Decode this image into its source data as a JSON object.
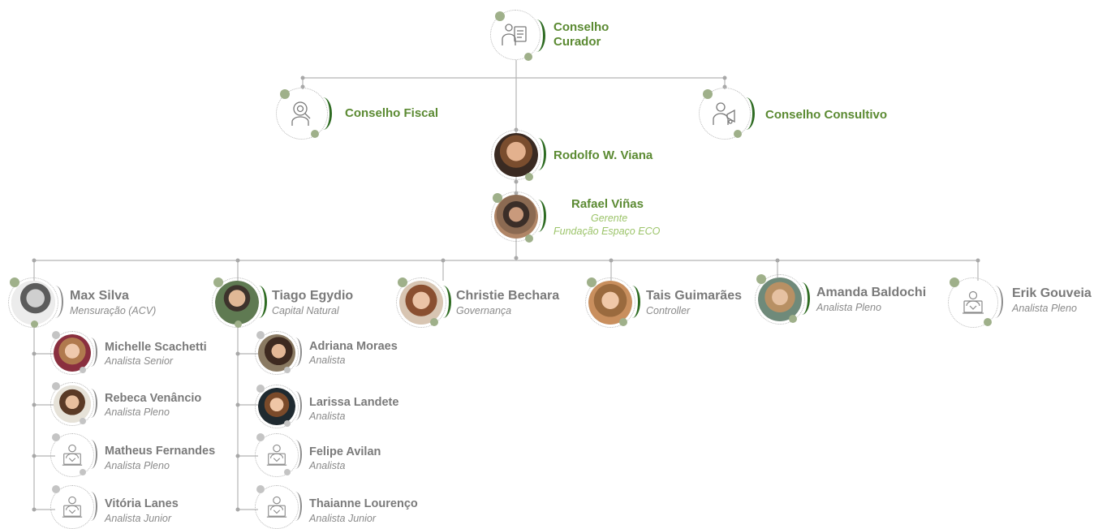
{
  "top": {
    "conselho_curador": "Conselho\nCurador",
    "conselho_fiscal": "Conselho Fiscal",
    "conselho_consultivo": "Conselho Consultivo",
    "director": "Rodolfo W. Viana",
    "manager": {
      "name": "Rafael Viñas",
      "role": "Gerente",
      "org": "Fundação Espaço ECO"
    }
  },
  "team": [
    {
      "name": "Max Silva",
      "role": "Mensuração (ACV)"
    },
    {
      "name": "Tiago Egydio",
      "role": "Capital Natural"
    },
    {
      "name": "Christie Bechara",
      "role": "Governança"
    },
    {
      "name": "Tais Guimarães",
      "role": "Controller"
    },
    {
      "name": "Amanda Baldochi",
      "role": "Analista Pleno"
    },
    {
      "name": "Erik Gouveia",
      "role": "Analista Pleno"
    }
  ],
  "max_team": [
    {
      "name": "Michelle Scachetti",
      "role": "Analista Senior"
    },
    {
      "name": "Rebeca Venâncio",
      "role": "Analista Pleno"
    },
    {
      "name": "Matheus Fernandes",
      "role": "Analista Pleno"
    },
    {
      "name": "Vitória Lanes",
      "role": "Analista Junior"
    }
  ],
  "tiago_team": [
    {
      "name": "Adriana Moraes",
      "role": "Analista"
    },
    {
      "name": "Larissa Landete",
      "role": "Analista"
    },
    {
      "name": "Felipe Avilan",
      "role": "Analista"
    },
    {
      "name": "Thaianne Lourenço",
      "role": "Analista Junior"
    }
  ],
  "colors": {
    "accent_green": "#5b8a32",
    "light_green": "#9cc46a",
    "dot_green": "#9fb08a",
    "line_gray": "#b5b5b5"
  },
  "icons": [
    "board-icon",
    "magnifier-person-icon",
    "advisor-megaphone-icon",
    "person-laptop-icon"
  ]
}
